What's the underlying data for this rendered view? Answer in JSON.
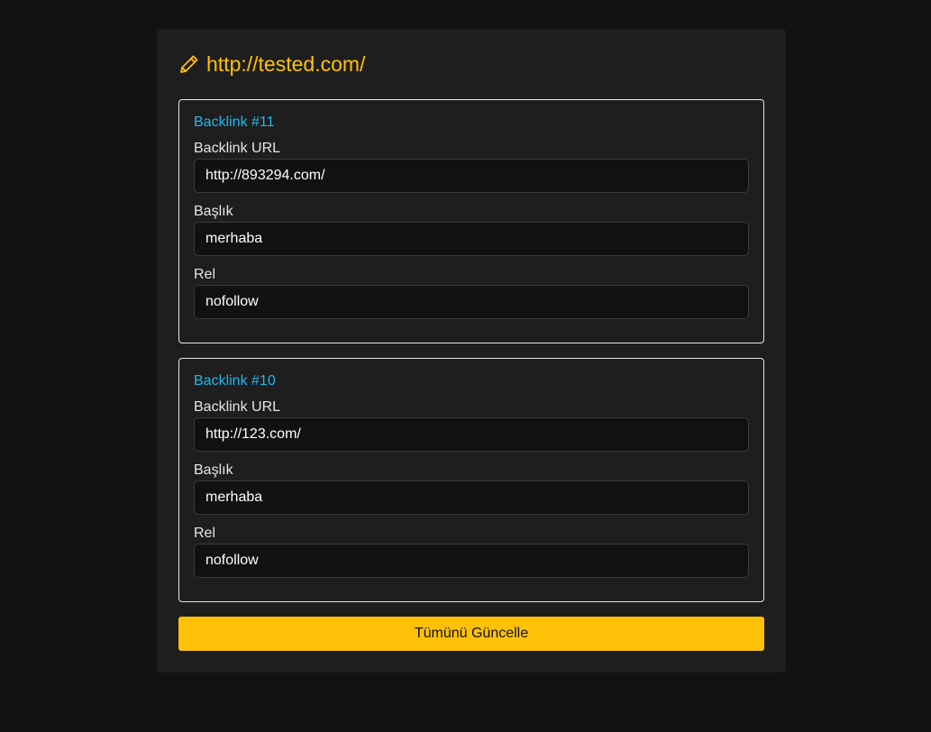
{
  "header": {
    "title": "http://tested.com/",
    "icon": "pencil-icon",
    "accent": "#ffc107"
  },
  "labels": {
    "url": "Backlink URL",
    "title": "Başlık",
    "rel": "Rel"
  },
  "backlinks": [
    {
      "heading": "Backlink #11",
      "url": "http://893294.com/",
      "title": "merhaba",
      "rel": "nofollow"
    },
    {
      "heading": "Backlink #10",
      "url": "http://123.com/",
      "title": "merhaba",
      "rel": "nofollow"
    }
  ],
  "actions": {
    "update_all": "Tümünü Güncelle"
  },
  "colors": {
    "background": "#121212",
    "panel": "#1e1e1e",
    "card_heading": "#20b8ee",
    "button": "#ffc107"
  }
}
